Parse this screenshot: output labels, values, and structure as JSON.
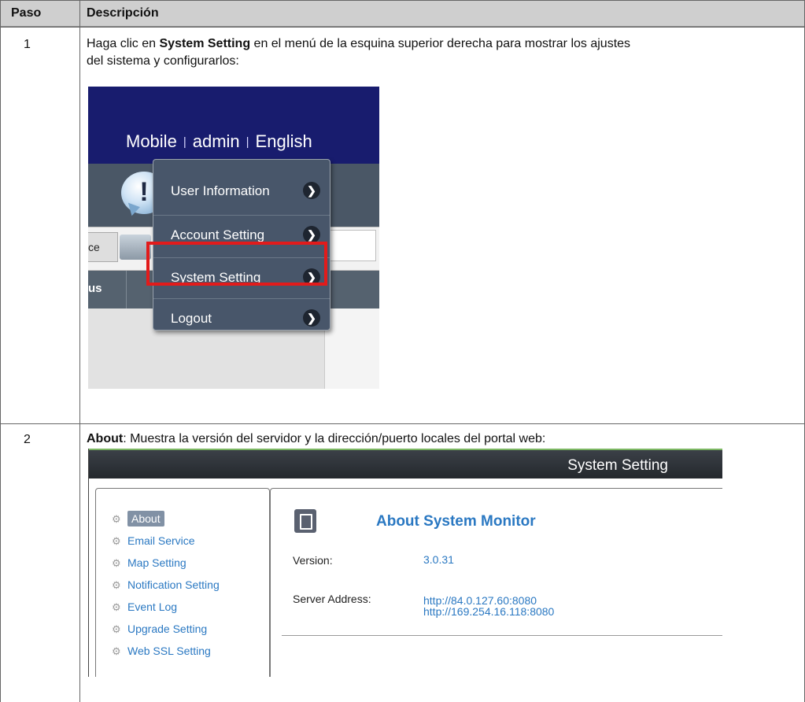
{
  "table": {
    "headers": {
      "step": "Paso",
      "description": "Descripción"
    },
    "rows": [
      {
        "step": "1",
        "text_before": "Haga clic en ",
        "bold": "System Setting",
        "text_line1_after": " en el menú de la esquina superior derecha para mostrar los ajustes",
        "text_line2": "del sistema y configurarlos:"
      },
      {
        "step": "2",
        "bold": "About",
        "text_after": ": Muestra la versión del servidor y la dirección/puerto locales del portal web:"
      }
    ]
  },
  "screenshot1": {
    "top_links": [
      "Mobile",
      "admin",
      "English"
    ],
    "link_separator": "|",
    "left_tab_fragment": "ce",
    "column_fragment": "us",
    "menu_items": [
      {
        "label": "User Information",
        "icon": "chevron-right-icon"
      },
      {
        "label": "Account Setting",
        "icon": "chevron-right-icon"
      },
      {
        "label": "System Setting",
        "icon": "chevron-right-icon",
        "highlighted": true
      },
      {
        "label": "Logout",
        "icon": "chevron-right-icon"
      }
    ],
    "highlight_color": "#e21b1b",
    "header_color": "#181c6e"
  },
  "screenshot2": {
    "window_title": "System Setting",
    "sidebar": [
      {
        "label": "About",
        "selected": true
      },
      {
        "label": "Email Service"
      },
      {
        "label": "Map Setting"
      },
      {
        "label": "Notification Setting"
      },
      {
        "label": "Event Log"
      },
      {
        "label": "Upgrade Setting"
      },
      {
        "label": "Web SSL Setting"
      }
    ],
    "panel_title": "About System Monitor",
    "version_label": "Version:",
    "version_value": "3.0.31",
    "server_label": "Server Address:",
    "server_values": [
      "http://84.0.127.60:8080",
      "http://169.254.16.118:8080"
    ],
    "link_color": "#2a78c2"
  }
}
